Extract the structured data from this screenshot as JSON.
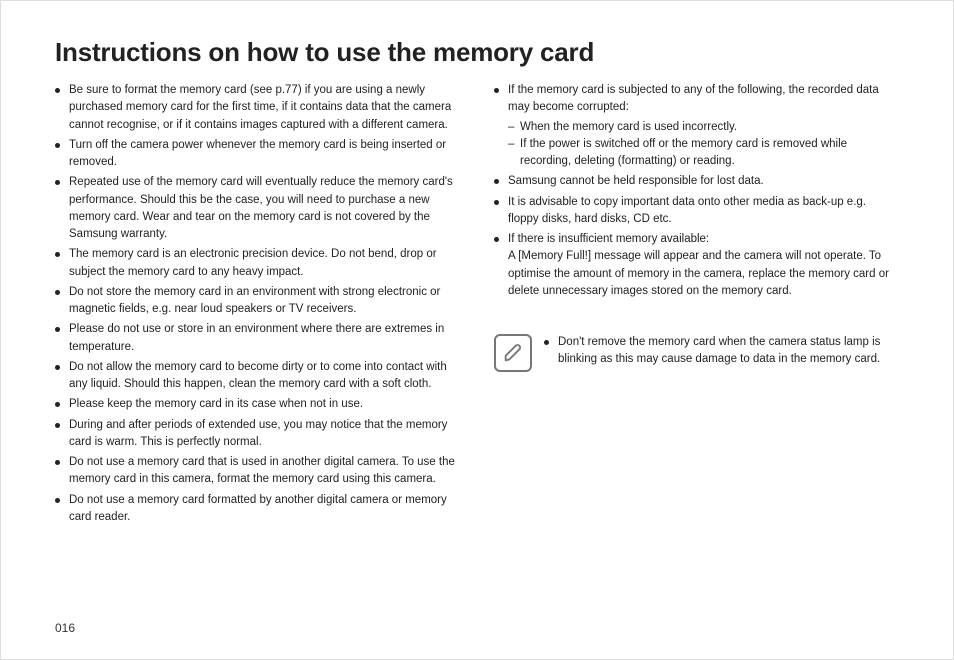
{
  "title": "Instructions on how to use the memory card",
  "page_number": "016",
  "left": {
    "items": [
      "Be sure to format the memory card (see p.77) if you are using a newly purchased memory card for the first time, if it contains data that the camera cannot recognise, or if it contains images captured with a different camera.",
      "Turn off the camera power whenever the memory card is being inserted or removed.",
      "Repeated use of the memory card will eventually reduce the memory card's performance. Should this be the case, you will need to purchase a new memory card. Wear and tear on the memory card is not covered by the Samsung warranty.",
      "The memory card is an electronic precision device. Do not bend, drop or subject the memory card to any heavy impact.",
      "Do not store the memory card in an environment with strong electronic or magnetic fields, e.g. near loud speakers or TV receivers.",
      "Please do not use or store in an environment where there are extremes in temperature.",
      "Do not allow the memory card to become dirty or to come into contact with any liquid. Should this happen, clean the memory card with a soft cloth.",
      "Please keep the memory card in its case when not in use.",
      "During and after periods of extended use, you may notice that the memory card is warm. This is perfectly normal.",
      "Do not use a memory card that is used in another digital camera. To use the memory card in this camera, format the memory card using this camera.",
      "Do not use a memory card formatted by another digital camera or memory card reader."
    ]
  },
  "right": {
    "items": [
      {
        "text": "If the memory card is subjected to any of the following, the recorded data may become corrupted:",
        "sub": [
          "When the memory card is used incorrectly.",
          "If the power is switched off or the memory card is removed while recording, deleting (formatting) or reading."
        ]
      },
      {
        "text": "Samsung cannot be held responsible for lost data."
      },
      {
        "text": "It is advisable to copy important data onto other media as back-up e.g. floppy disks, hard disks, CD etc."
      },
      {
        "text": "If there is insufficient memory available:",
        "followup": "A [Memory Full!] message will appear and the camera will not operate. To optimise the amount of memory in the camera, replace the memory card or delete unnecessary images stored on the memory card."
      }
    ],
    "note": {
      "items": [
        "Don't remove the memory card when the camera status lamp is blinking as this may cause damage to data in the memory card."
      ]
    }
  }
}
